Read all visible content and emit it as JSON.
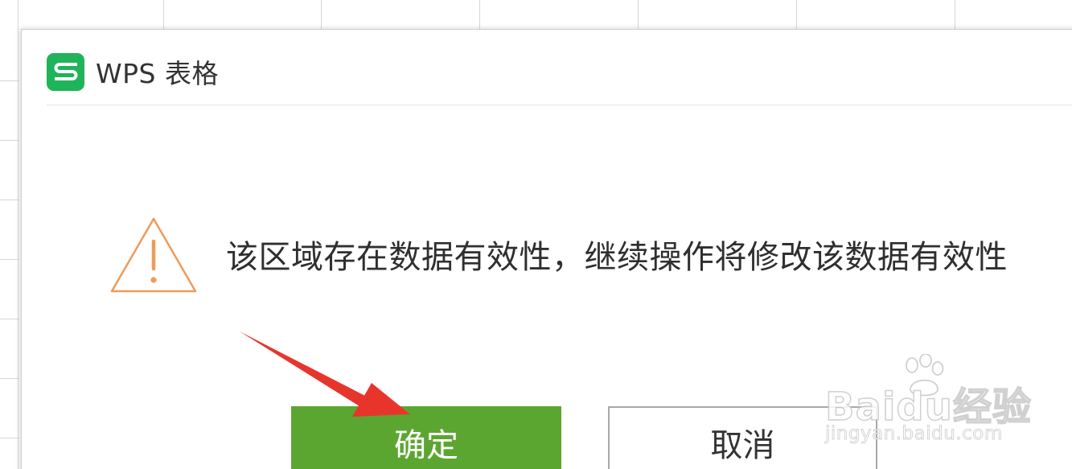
{
  "window": {
    "title": "WPS 表格",
    "app_icon": "wps-spreadsheet-icon",
    "app_icon_letter": "S"
  },
  "dialog": {
    "icon": "warning-icon",
    "message": "该区域存在数据有效性，继续操作将修改该数据有效性",
    "ok_label": "确定",
    "cancel_label": "取消"
  },
  "annotation": {
    "icon": "red-arrow-icon"
  },
  "watermark": {
    "brand": "Baidu经验",
    "url": "jingyan.baidu.com"
  },
  "colors": {
    "app_icon": "#1fb35a",
    "ok_button": "#5ba630",
    "warning": "#ef9a5b",
    "arrow": "#e8352c"
  }
}
